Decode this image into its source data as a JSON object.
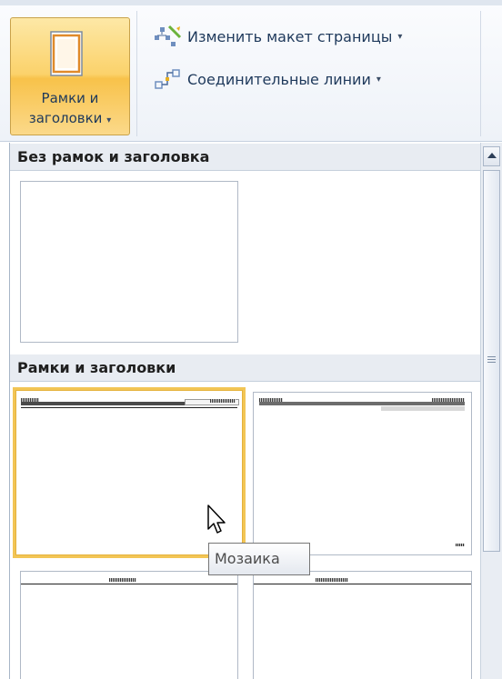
{
  "ribbon": {
    "borders_titles_button": {
      "line1": "Рамки и",
      "line2": "заголовки",
      "arrow": "▾",
      "icon": "page-icon"
    },
    "change_layout": {
      "label": "Изменить макет страницы",
      "arrow": "▾",
      "icon": "layout-change-icon"
    },
    "connector_lines": {
      "label": "Соединительные линии",
      "arrow": "▾",
      "icon": "connector-icon"
    }
  },
  "gallery": {
    "sections": [
      {
        "title": "Без рамок и заголовка",
        "items": [
          "none"
        ]
      },
      {
        "title": "Рамки и заголовки",
        "items": [
          "Мозаика",
          "style-2",
          "style-3",
          "style-4"
        ]
      }
    ],
    "selected_item": "Мозаика"
  },
  "tooltip": {
    "text": "Мозаика"
  },
  "colors": {
    "selection": "#f2c555",
    "button_hover": "#fbd26b",
    "accent_text": "#1e395b"
  }
}
